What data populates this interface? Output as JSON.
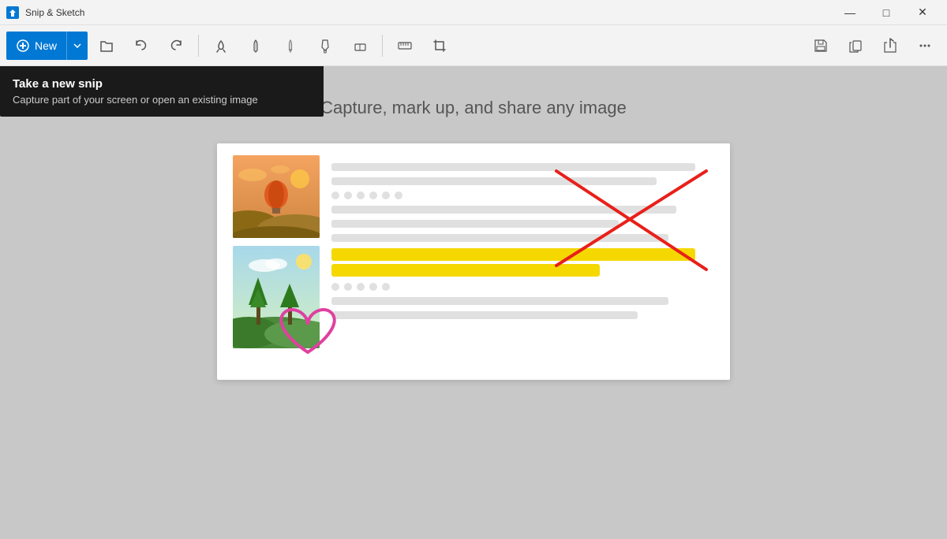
{
  "app": {
    "title": "Snip & Sketch"
  },
  "titlebar": {
    "title": "Snip & Sketch",
    "minimize_label": "—",
    "maximize_label": "□",
    "close_label": "✕"
  },
  "toolbar": {
    "new_label": "New",
    "tools": [
      {
        "name": "open",
        "icon": "🗁",
        "label": "Open"
      },
      {
        "name": "undo",
        "icon": "↩",
        "label": "Undo"
      },
      {
        "name": "redo",
        "icon": "↪",
        "label": "Redo"
      },
      {
        "name": "touch-writing",
        "icon": "✋",
        "label": "Touch Writing"
      },
      {
        "name": "ballpoint-pen",
        "icon": "▽",
        "label": "Ballpoint Pen"
      },
      {
        "name": "pencil",
        "icon": "▽",
        "label": "Pencil"
      },
      {
        "name": "highlighter",
        "icon": "▽",
        "label": "Highlighter"
      },
      {
        "name": "eraser",
        "icon": "◇",
        "label": "Eraser"
      },
      {
        "name": "ruler",
        "icon": "✏",
        "label": "Ruler"
      },
      {
        "name": "crop",
        "icon": "⊡",
        "label": "Crop"
      }
    ],
    "right_tools": [
      {
        "name": "save",
        "icon": "💾",
        "label": "Save"
      },
      {
        "name": "copy",
        "icon": "⎘",
        "label": "Copy"
      },
      {
        "name": "share",
        "icon": "↗",
        "label": "Share"
      },
      {
        "name": "more",
        "icon": "⋯",
        "label": "More"
      }
    ]
  },
  "tooltip": {
    "title": "Take a new snip",
    "subtitle": "Capture part of your screen or open an existing image"
  },
  "main": {
    "heading": "Capture, mark up, and share any image"
  }
}
